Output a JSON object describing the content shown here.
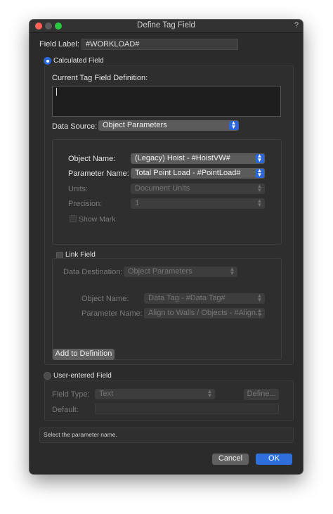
{
  "window": {
    "title": "Define Tag Field",
    "help": "?"
  },
  "field_label": {
    "label": "Field Label:",
    "value": "#WORKLOAD#"
  },
  "calculated": {
    "radio_label": "Calculated Field",
    "selected": true
  },
  "definition": {
    "label": "Current Tag Field Definition:",
    "value": ""
  },
  "data_source": {
    "label": "Data Source:",
    "value": "Object Parameters"
  },
  "object_name": {
    "label": "Object Name:",
    "value": "(Legacy) Hoist - #HoistVW#"
  },
  "parameter_name": {
    "label": "Parameter Name:",
    "value": "Total Point Load - #PointLoad#"
  },
  "units": {
    "label": "Units:",
    "value": "Document Units"
  },
  "precision": {
    "label": "Precision:",
    "value": "1"
  },
  "show_mark": {
    "label": "Show Mark"
  },
  "link_field": {
    "label": "Link Field",
    "data_destination": {
      "label": "Data Destination:",
      "value": "Object Parameters"
    },
    "object_name": {
      "label": "Object Name:",
      "value": "Data Tag - #Data Tag#"
    },
    "parameter_name": {
      "label": "Parameter Name:",
      "value": "Align to Walls / Objects - #Align..."
    }
  },
  "add_button": "Add to Definition",
  "user_entered": {
    "radio_label": "User-entered Field",
    "field_type": {
      "label": "Field Type:",
      "value": "Text"
    },
    "define_button": "Define...",
    "default": {
      "label": "Default:",
      "value": ""
    }
  },
  "status": "Select the parameter name.",
  "footer": {
    "cancel": "Cancel",
    "ok": "OK"
  },
  "colors": {
    "accent": "#2a67d8",
    "window_bg": "#2b2b2b"
  }
}
